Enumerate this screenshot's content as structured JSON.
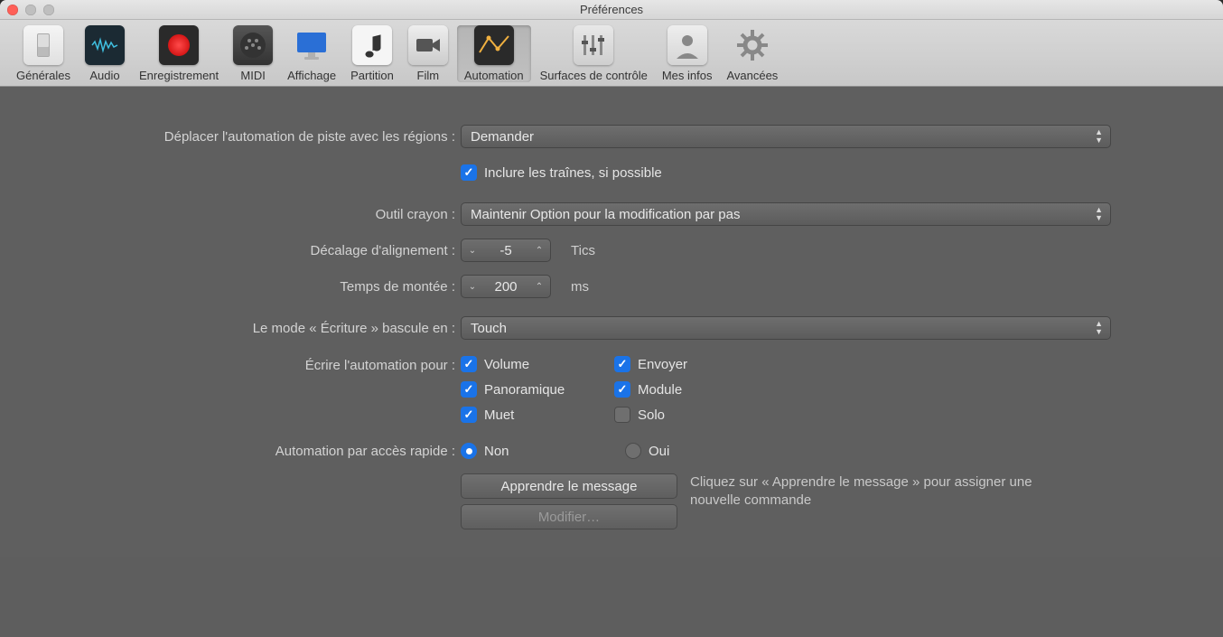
{
  "window": {
    "title": "Préférences"
  },
  "toolbar": {
    "items": [
      {
        "label": "Générales"
      },
      {
        "label": "Audio"
      },
      {
        "label": "Enregistrement"
      },
      {
        "label": "MIDI"
      },
      {
        "label": "Affichage"
      },
      {
        "label": "Partition"
      },
      {
        "label": "Film"
      },
      {
        "label": "Automation"
      },
      {
        "label": "Surfaces de contrôle"
      },
      {
        "label": "Mes infos"
      },
      {
        "label": "Avancées"
      }
    ],
    "selectedIndex": 7
  },
  "form": {
    "moveAutomation": {
      "label": "Déplacer l'automation de piste avec les régions :",
      "value": "Demander"
    },
    "includeTails": {
      "label": "Inclure les traînes, si possible",
      "checked": true
    },
    "pencilTool": {
      "label": "Outil crayon :",
      "value": "Maintenir Option pour la modification par pas"
    },
    "snapOffset": {
      "label": "Décalage d'alignement :",
      "value": "-5",
      "unit": "Tics"
    },
    "rampTime": {
      "label": "Temps de montée :",
      "value": "200",
      "unit": "ms"
    },
    "writeMode": {
      "label": "Le mode « Écriture » bascule en :",
      "value": "Touch"
    },
    "writeAutoFor": {
      "label": "Écrire l'automation pour :",
      "items": [
        {
          "label": "Volume",
          "checked": true
        },
        {
          "label": "Envoyer",
          "checked": true
        },
        {
          "label": "Panoramique",
          "checked": true
        },
        {
          "label": "Module",
          "checked": true
        },
        {
          "label": "Muet",
          "checked": true
        },
        {
          "label": "Solo",
          "checked": false
        }
      ]
    },
    "quickAccess": {
      "label": "Automation par accès rapide :",
      "options": [
        {
          "label": "Non",
          "selected": true
        },
        {
          "label": "Oui",
          "selected": false
        }
      ]
    },
    "learn": {
      "label": "Apprendre le message"
    },
    "edit": {
      "label": "Modifier…"
    },
    "hint": "Cliquez sur « Apprendre le message » pour assigner une nouvelle commande"
  }
}
